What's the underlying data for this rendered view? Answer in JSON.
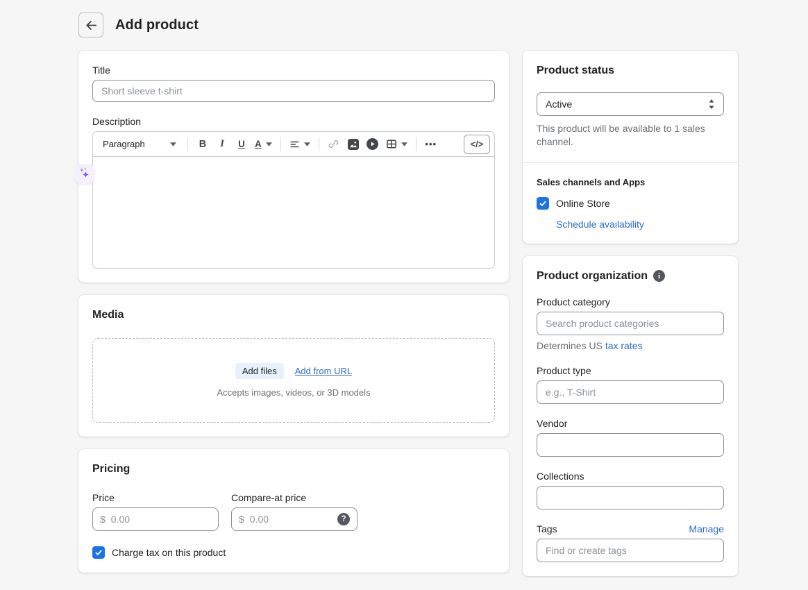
{
  "colors": {
    "page-bg": "#f6f6f7",
    "link": "#2c6ecb",
    "checkbox": "#1a73e8",
    "addfiles-bg": "#e7f0fd"
  },
  "header": {
    "title": "Add product"
  },
  "main": {
    "details_card": {
      "title_label": "Title",
      "title_placeholder": "Short sleeve t-shirt",
      "description_label": "Description",
      "toolbar": {
        "paragraph": "Paragraph",
        "bold": "B",
        "italic": "I",
        "underline": "U",
        "text_color": "A",
        "more": "•••",
        "code": "</>"
      }
    },
    "media_card": {
      "heading": "Media",
      "add_files": "Add files",
      "add_from_url": "Add from URL",
      "helper": "Accepts images, videos, or 3D models"
    },
    "pricing_card": {
      "heading": "Pricing",
      "price_label": "Price",
      "compare_at_label": "Compare-at price",
      "currency_prefix": "$",
      "price_placeholder": "0.00",
      "compare_placeholder": "0.00",
      "charge_tax_label": "Charge tax on this product"
    }
  },
  "sidebar": {
    "status_card": {
      "heading": "Product status",
      "status_value": "Active",
      "helper": "This product will be available to 1 sales channel.",
      "sales_heading": "Sales channels and Apps",
      "channel_label": "Online Store",
      "schedule_link": "Schedule availability"
    },
    "organization_card": {
      "heading": "Product organization",
      "category_label": "Product category",
      "category_placeholder": "Search product categories",
      "category_helper_prefix": "Determines US ",
      "category_helper_link": "tax rates",
      "type_label": "Product type",
      "type_placeholder": "e.g., T-Shirt",
      "vendor_label": "Vendor",
      "collections_label": "Collections",
      "tags_label": "Tags",
      "manage_link": "Manage",
      "tags_placeholder": "Find or create tags"
    }
  }
}
